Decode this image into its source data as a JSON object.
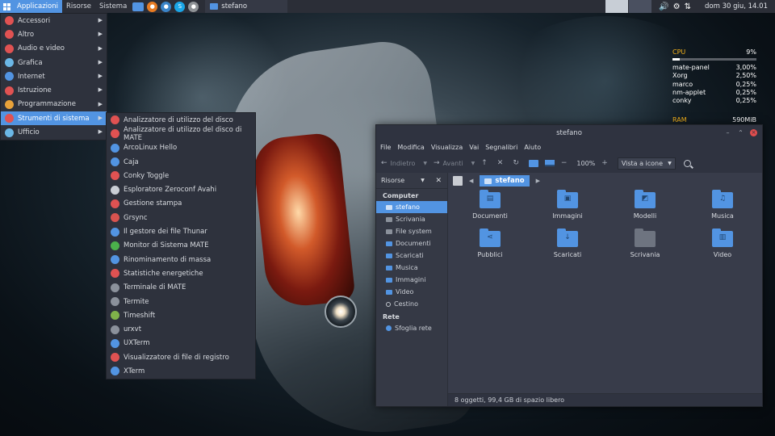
{
  "panel": {
    "menus": [
      "Applicazioni",
      "Risorse",
      "Sistema"
    ],
    "task_label": "stefano",
    "clock": "dom 30 giu, 14.01"
  },
  "app_menu": {
    "items": [
      {
        "label": "Accessori",
        "icon": "accessories-icon",
        "color": "#e05252"
      },
      {
        "label": "Altro",
        "icon": "other-icon",
        "color": "#e05252"
      },
      {
        "label": "Audio e video",
        "icon": "multimedia-icon",
        "color": "#e05252"
      },
      {
        "label": "Grafica",
        "icon": "graphics-icon",
        "color": "#6bb7e6"
      },
      {
        "label": "Internet",
        "icon": "internet-icon",
        "color": "#5294e2"
      },
      {
        "label": "Istruzione",
        "icon": "education-icon",
        "color": "#e05252"
      },
      {
        "label": "Programmazione",
        "icon": "development-icon",
        "color": "#e8a23a"
      },
      {
        "label": "Strumenti di sistema",
        "icon": "system-tools-icon",
        "color": "#e05252"
      },
      {
        "label": "Ufficio",
        "icon": "office-icon",
        "color": "#6bb7e6"
      }
    ]
  },
  "submenu": {
    "items": [
      {
        "label": "Analizzatore di utilizzo del disco",
        "color": "#e05252"
      },
      {
        "label": "Analizzatore di utilizzo del disco di MATE",
        "color": "#e05252"
      },
      {
        "label": "ArcoLinux Hello",
        "color": "#5294e2"
      },
      {
        "label": "Caja",
        "color": "#5294e2"
      },
      {
        "label": "Conky Toggle",
        "color": "#e05252"
      },
      {
        "label": "Esploratore Zeroconf Avahi",
        "color": "#c9cdd4"
      },
      {
        "label": "Gestione stampa",
        "color": "#e05252"
      },
      {
        "label": "Grsync",
        "color": "#d9534f"
      },
      {
        "label": "Il gestore dei file Thunar",
        "color": "#5294e2"
      },
      {
        "label": "Monitor di Sistema MATE",
        "color": "#4bb04b"
      },
      {
        "label": "Rinominamento di massa",
        "color": "#5294e2"
      },
      {
        "label": "Statistiche energetiche",
        "color": "#e05252"
      },
      {
        "label": "Terminale di MATE",
        "color": "#8b919b"
      },
      {
        "label": "Termite",
        "color": "#8b919b"
      },
      {
        "label": "Timeshift",
        "color": "#7fb24a"
      },
      {
        "label": "urxvt",
        "color": "#8b919b"
      },
      {
        "label": "UXTerm",
        "color": "#5294e2"
      },
      {
        "label": "Visualizzatore di file di registro",
        "color": "#e05252"
      },
      {
        "label": "XTerm",
        "color": "#5294e2"
      }
    ]
  },
  "conky": {
    "cpu_label": "CPU",
    "cpu_value": "9%",
    "cpu_fraction": 0.09,
    "processes": [
      {
        "name": "mate-panel",
        "value": "3,00%"
      },
      {
        "name": "Xorg",
        "value": "2,50%"
      },
      {
        "name": "marco",
        "value": "0,25%"
      },
      {
        "name": "nm-applet",
        "value": "0,25%"
      },
      {
        "name": "conky",
        "value": "0,25%"
      }
    ],
    "ram_label": "RAM",
    "ram_value": "590MiB"
  },
  "window": {
    "title": "stefano",
    "menubar": [
      "File",
      "Modifica",
      "Visualizza",
      "Vai",
      "Segnalibri",
      "Aiuto"
    ],
    "toolbar": {
      "back": "Indietro",
      "forward": "Avanti",
      "zoom": "100%",
      "view_mode": "Vista a icone"
    },
    "sidebar": {
      "header": "Risorse",
      "computer_label": "Computer",
      "computer_items": [
        {
          "label": "stefano",
          "type": "folder"
        },
        {
          "label": "Scrivania",
          "type": "drive"
        },
        {
          "label": "File system",
          "type": "drive"
        },
        {
          "label": "Documenti",
          "type": "folder"
        },
        {
          "label": "Scaricati",
          "type": "folder"
        },
        {
          "label": "Musica",
          "type": "folder"
        },
        {
          "label": "Immagini",
          "type": "folder"
        },
        {
          "label": "Video",
          "type": "folder"
        },
        {
          "label": "Cestino",
          "type": "trash"
        }
      ],
      "network_label": "Rete",
      "network_items": [
        {
          "label": "Sfoglia rete",
          "type": "net"
        }
      ]
    },
    "location": "stefano",
    "files": [
      {
        "label": "Documenti",
        "glyph": "▤",
        "gray": false
      },
      {
        "label": "Immagini",
        "glyph": "▣",
        "gray": false
      },
      {
        "label": "Modelli",
        "glyph": "◩",
        "gray": false
      },
      {
        "label": "Musica",
        "glyph": "♫",
        "gray": false
      },
      {
        "label": "Pubblici",
        "glyph": "⋖",
        "gray": false
      },
      {
        "label": "Scaricati",
        "glyph": "↓",
        "gray": false
      },
      {
        "label": "Scrivania",
        "glyph": "",
        "gray": true
      },
      {
        "label": "Video",
        "glyph": "▥",
        "gray": false
      }
    ],
    "status": "8 oggetti, 99,4 GB di spazio libero"
  }
}
